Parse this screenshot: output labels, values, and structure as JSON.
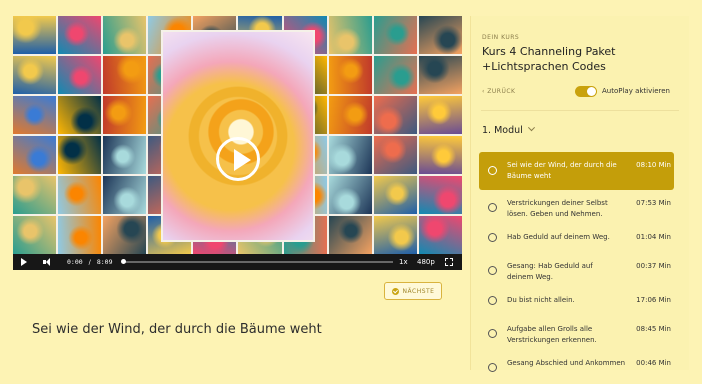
{
  "video": {
    "current_time": "0:00",
    "separator": "/",
    "duration": "8:09",
    "speed": "1x",
    "quality": "480p"
  },
  "next_button": {
    "label": "NÄCHSTE"
  },
  "lesson_title": "Sei wie der Wind, der durch die Bäume weht",
  "sidebar": {
    "course_label": "DEIN KURS",
    "course_title": "Kurs 4 Channeling Paket +Lichtsprachen Codes",
    "back_label": "‹ ZURÜCK",
    "autoplay_label": "AutoPlay aktivieren",
    "autoplay_on": true,
    "module_label": "1. Modul",
    "lessons": [
      {
        "name": "Sei wie der Wind, der durch die Bäume weht",
        "duration": "08:10 Min",
        "active": true
      },
      {
        "name": "Verstrickungen deiner Selbst lösen. Geben und Nehmen.",
        "duration": "07:53 Min",
        "active": false
      },
      {
        "name": "Hab Geduld auf deinem Weg.",
        "duration": "01:04 Min",
        "active": false
      },
      {
        "name": "Gesang: Hab Geduld auf deinem Weg.",
        "duration": "00:37 Min",
        "active": false
      },
      {
        "name": "Du bist nicht allein.",
        "duration": "17:06 Min",
        "active": false
      },
      {
        "name": "Aufgabe allen Grolls alle Verstrickungen erkennen.",
        "duration": "08:45 Min",
        "active": false
      },
      {
        "name": "Gesang Abschied und Ankommen",
        "duration": "00:46 Min",
        "active": false
      }
    ]
  },
  "colors": {
    "background": "#fdf3b4",
    "accent": "#c49e0a",
    "active_lesson": "#c49e0a"
  }
}
